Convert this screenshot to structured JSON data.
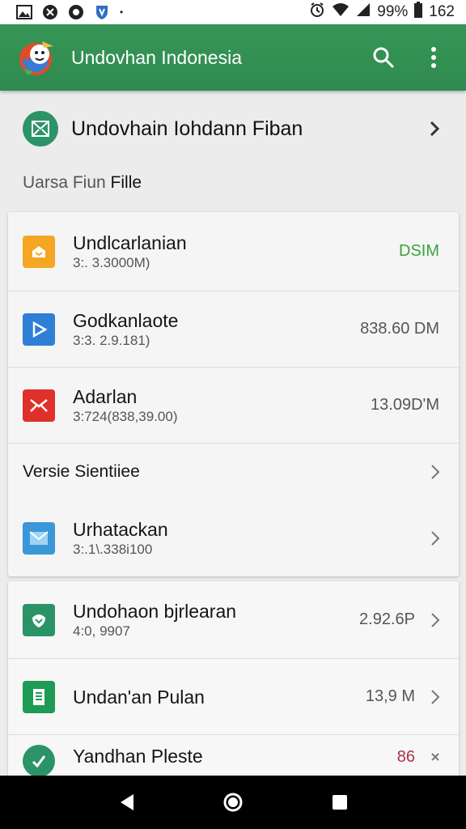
{
  "status_bar": {
    "battery_text": "99%",
    "time": "162",
    "icons": [
      "image-icon",
      "settings-circle-icon",
      "record-icon",
      "shield-icon",
      "alarm-icon",
      "wifi-icon",
      "signal-icon",
      "battery-icon"
    ]
  },
  "app_bar": {
    "title": "Undovhan Indonesia",
    "icons": [
      "search-icon",
      "more-vert-icon"
    ],
    "color": "#379657"
  },
  "top_item": {
    "label": "Undovhain Iohdann Fiban"
  },
  "section": {
    "label_prefix": "Uarsa Fiun ",
    "label_bold": "Fille"
  },
  "card1": {
    "rows": [
      {
        "title": "Undlcarlanian",
        "subtitle": "3:. 3.3000M)",
        "value": "DSIM",
        "icon": "orange-box-icon",
        "color": "#f5a623"
      },
      {
        "title": "Godkanlaote",
        "subtitle": "3:3. 2.9.181)",
        "value": "838.60 DM",
        "icon": "play-triangle-icon",
        "color": "#2f7fd6"
      },
      {
        "title": "Adarlan",
        "subtitle": "3:724(838,39.00)",
        "value": "13.09D'M",
        "icon": "red-x-icon",
        "color": "#e0302b"
      },
      {
        "title": "Versie Sientiiee",
        "subtitle": "",
        "value": "",
        "icon": "",
        "color": ""
      },
      {
        "title": "Urhatackan",
        "subtitle": "3:.1\\.338i100",
        "value": "",
        "icon": "envelope-icon",
        "color": "#3a97d8"
      }
    ]
  },
  "card2": {
    "rows": [
      {
        "title": "Undohaon bjrlearan",
        "subtitle": "4:0,  9907",
        "value": "2.92.6P",
        "icon": "green-leaf-icon",
        "color": "#2b9467"
      },
      {
        "title": "Undan'an Pulan",
        "subtitle": "",
        "value": "13,9 M",
        "icon": "document-icon",
        "color": "#1f9b55"
      },
      {
        "title": "Yandhan Pleste",
        "subtitle": "",
        "value": "86",
        "icon": "checkmark-icon",
        "color": "#2b9467"
      }
    ]
  },
  "nav_bar": {
    "icons": [
      "back-icon",
      "home-icon",
      "recents-icon"
    ]
  }
}
